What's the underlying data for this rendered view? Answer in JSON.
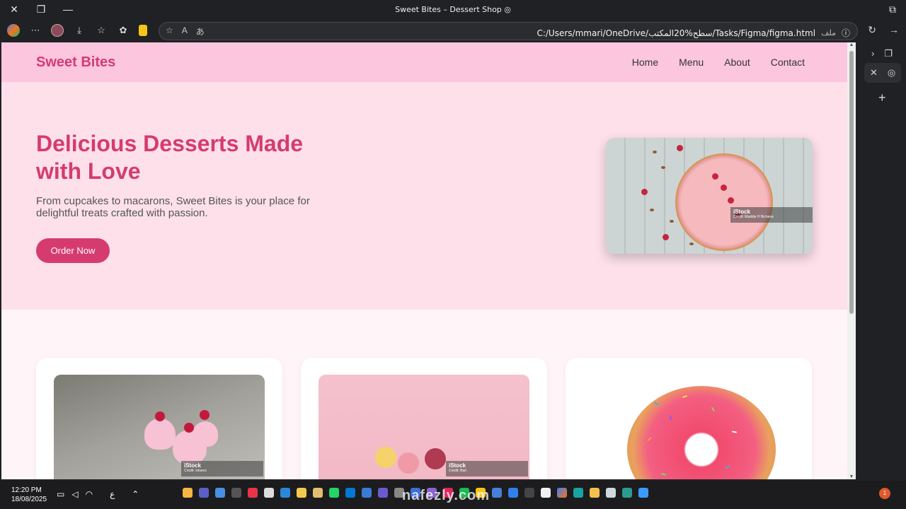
{
  "window": {
    "title": "Sweet Bites – Dessert Shop"
  },
  "toolbar": {
    "url": "C:/Users/mmari/OneDrive/سطح%20المكتب/Tasks/Figma/figma.html",
    "file_tag": "ملف"
  },
  "site": {
    "brand": "Sweet Bites",
    "nav": [
      "Home",
      "Menu",
      "About",
      "Contact"
    ],
    "hero": {
      "title": "Delicious Desserts Made with Love",
      "subtitle": "From cupcakes to macarons, Sweet Bites is your place for delightful treats crafted with passion.",
      "cta": "Order Now",
      "image_credit_brand": "iStock",
      "image_credit_line": "Credit: Maddie H Bicheva"
    },
    "cards": [
      {
        "credit_brand": "iStock",
        "credit_line": "Credit: xinsrez"
      },
      {
        "credit_brand": "iStock",
        "credit_line": "Credit: Bari"
      },
      {
        "credit_brand": "",
        "credit_line": ""
      }
    ]
  },
  "taskbar": {
    "time": "12:20 PM",
    "date": "18/08/2025",
    "lang": "ع",
    "notif_count": "1",
    "watermark": "nafezly.com"
  },
  "colors": {
    "brand_pink": "#d63b70",
    "header_bg": "#fcc6df",
    "hero_bg": "#fde0ea"
  }
}
